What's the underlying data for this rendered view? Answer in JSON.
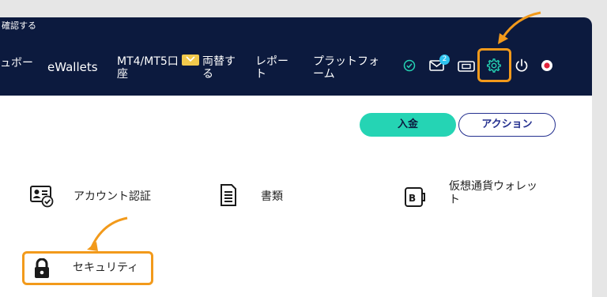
{
  "top_strip": {
    "text": "確認する"
  },
  "nav": {
    "items": [
      {
        "line1": "ュボー",
        "line2": ""
      },
      {
        "line1": "eWallets",
        "line2": ""
      },
      {
        "line1": "MT4/MT5口",
        "line2": "座"
      },
      {
        "line1": "両替す",
        "line2": "る"
      },
      {
        "line1": "レポー",
        "line2": "ト"
      },
      {
        "line1": "プラットフォ",
        "line2": "ーム"
      }
    ],
    "notification_count": "2",
    "icons": [
      "check-circle-icon",
      "mail-icon",
      "ticket-icon",
      "gear-icon",
      "power-icon",
      "flag-icon"
    ]
  },
  "actions": {
    "deposit": "入金",
    "action": "アクション"
  },
  "menu": {
    "account_verification": "アカウント認証",
    "documents": "書類",
    "crypto_wallet_line1": "仮想通貨ウォレッ",
    "crypto_wallet_line2": "ト",
    "security": "セキュリティ"
  },
  "colors": {
    "nav_bg": "#0c1a3e",
    "accent": "#25d4b4",
    "highlight": "#f29a1b",
    "badge": "#2ec4f0"
  }
}
